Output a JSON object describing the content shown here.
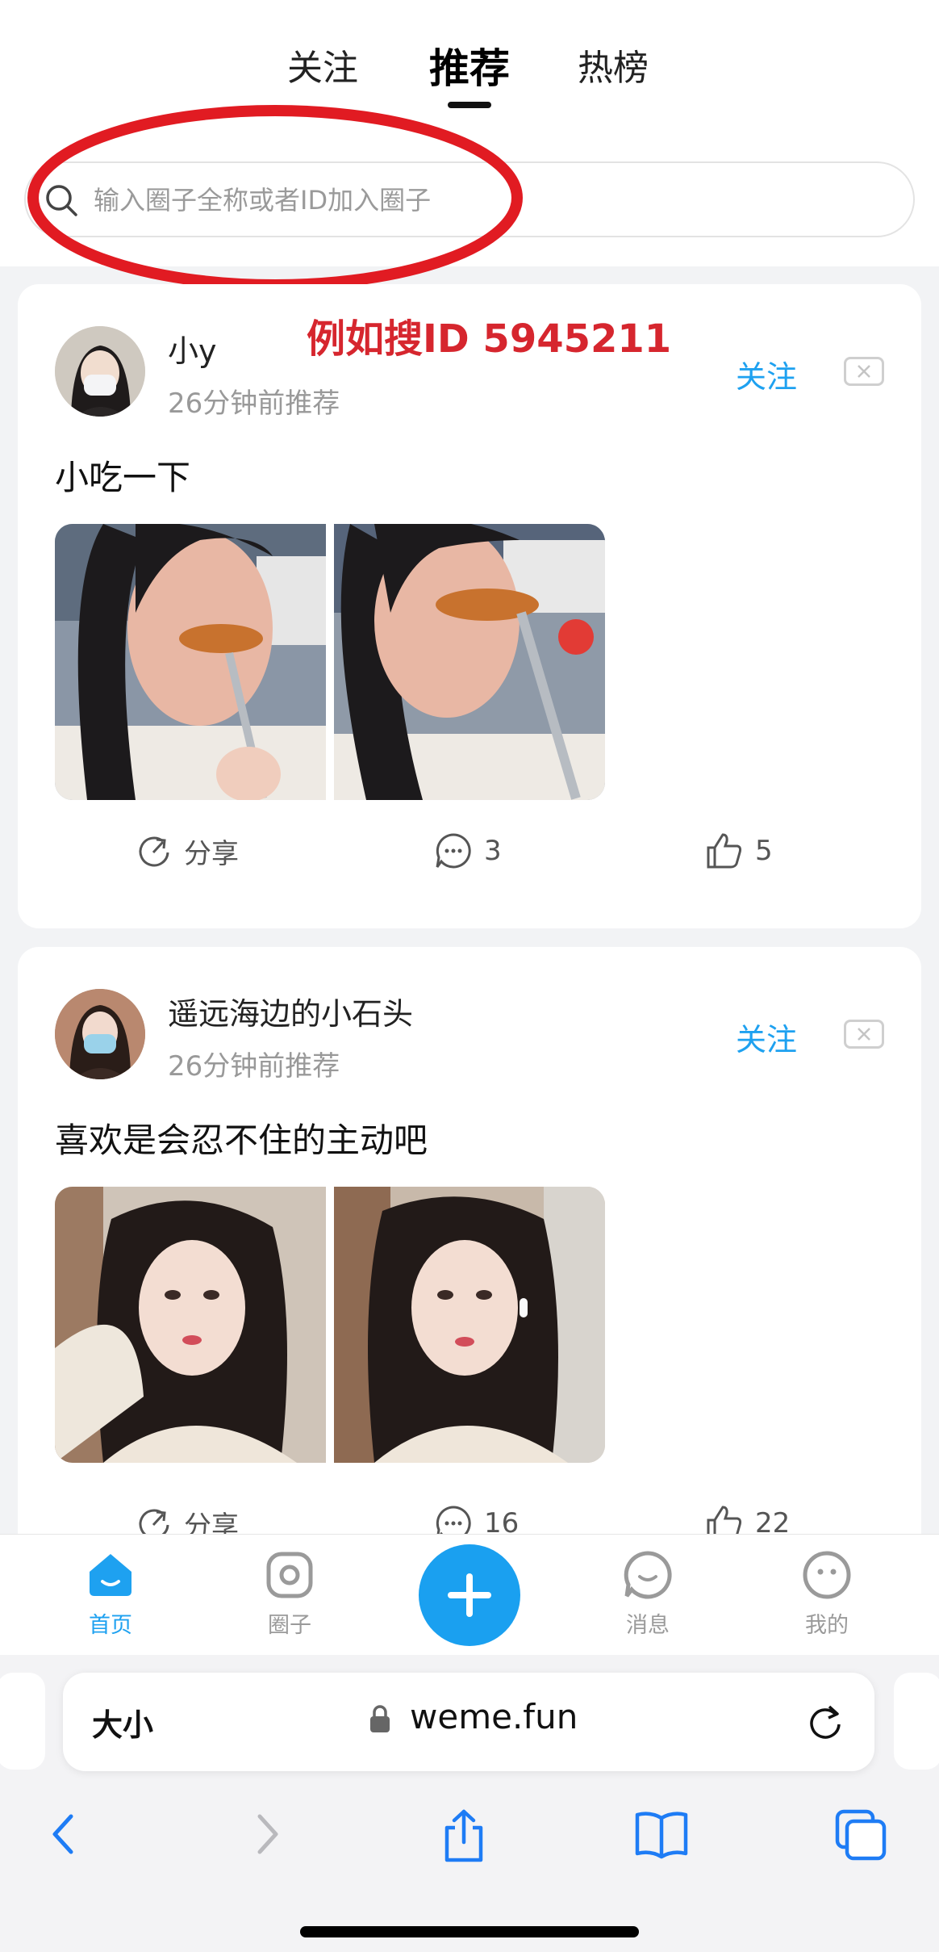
{
  "tabs": [
    {
      "label": "关注",
      "active": false
    },
    {
      "label": "推荐",
      "active": true
    },
    {
      "label": "热榜",
      "active": false
    }
  ],
  "search": {
    "placeholder": "输入圈子全称或者ID加入圈子"
  },
  "annotation": "例如搜ID 5945211",
  "posts": [
    {
      "username": "小y",
      "time": "26分钟前推荐",
      "follow_label": "关注",
      "text": "小吃一下",
      "share_label": "分享",
      "comments": "3",
      "likes": "5"
    },
    {
      "username": "遥远海边的小石头",
      "time": "26分钟前推荐",
      "follow_label": "关注",
      "text": "喜欢是会忍不住的主动吧",
      "share_label": "分享",
      "comments": "16",
      "likes": "22"
    }
  ],
  "bottom_nav": [
    {
      "label": "首页",
      "icon": "home-icon",
      "active": true
    },
    {
      "label": "圈子",
      "icon": "circle-icon",
      "active": false
    },
    {
      "label": "消息",
      "icon": "message-icon",
      "active": false
    },
    {
      "label": "我的",
      "icon": "profile-icon",
      "active": false
    }
  ],
  "browser": {
    "text_size_label": "大小",
    "url": "weme.fun"
  },
  "colors": {
    "accent": "#1ea1f0",
    "annotation": "#d6262e"
  }
}
